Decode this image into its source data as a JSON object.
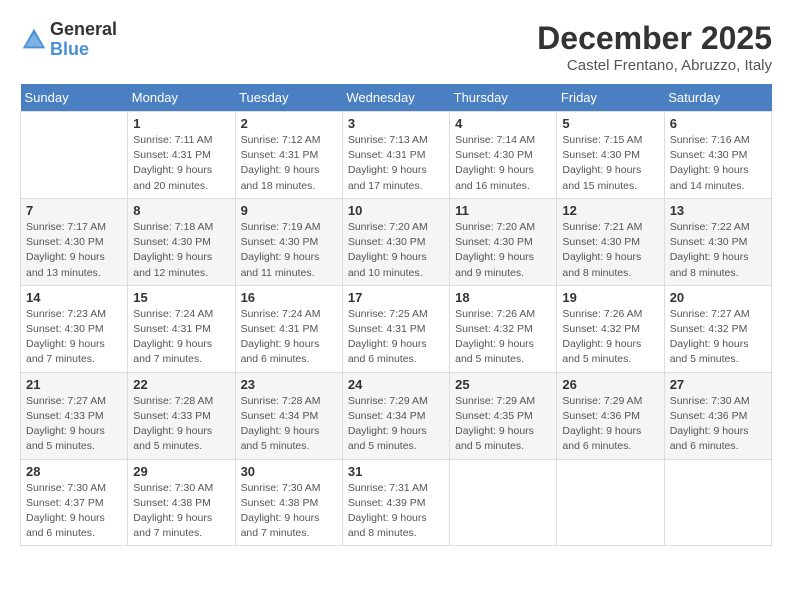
{
  "header": {
    "logo_general": "General",
    "logo_blue": "Blue",
    "month_title": "December 2025",
    "location": "Castel Frentano, Abruzzo, Italy"
  },
  "calendar": {
    "days_of_week": [
      "Sunday",
      "Monday",
      "Tuesday",
      "Wednesday",
      "Thursday",
      "Friday",
      "Saturday"
    ],
    "weeks": [
      [
        {
          "day": "",
          "info": ""
        },
        {
          "day": "1",
          "info": "Sunrise: 7:11 AM\nSunset: 4:31 PM\nDaylight: 9 hours\nand 20 minutes."
        },
        {
          "day": "2",
          "info": "Sunrise: 7:12 AM\nSunset: 4:31 PM\nDaylight: 9 hours\nand 18 minutes."
        },
        {
          "day": "3",
          "info": "Sunrise: 7:13 AM\nSunset: 4:31 PM\nDaylight: 9 hours\nand 17 minutes."
        },
        {
          "day": "4",
          "info": "Sunrise: 7:14 AM\nSunset: 4:30 PM\nDaylight: 9 hours\nand 16 minutes."
        },
        {
          "day": "5",
          "info": "Sunrise: 7:15 AM\nSunset: 4:30 PM\nDaylight: 9 hours\nand 15 minutes."
        },
        {
          "day": "6",
          "info": "Sunrise: 7:16 AM\nSunset: 4:30 PM\nDaylight: 9 hours\nand 14 minutes."
        }
      ],
      [
        {
          "day": "7",
          "info": "Sunrise: 7:17 AM\nSunset: 4:30 PM\nDaylight: 9 hours\nand 13 minutes."
        },
        {
          "day": "8",
          "info": "Sunrise: 7:18 AM\nSunset: 4:30 PM\nDaylight: 9 hours\nand 12 minutes."
        },
        {
          "day": "9",
          "info": "Sunrise: 7:19 AM\nSunset: 4:30 PM\nDaylight: 9 hours\nand 11 minutes."
        },
        {
          "day": "10",
          "info": "Sunrise: 7:20 AM\nSunset: 4:30 PM\nDaylight: 9 hours\nand 10 minutes."
        },
        {
          "day": "11",
          "info": "Sunrise: 7:20 AM\nSunset: 4:30 PM\nDaylight: 9 hours\nand 9 minutes."
        },
        {
          "day": "12",
          "info": "Sunrise: 7:21 AM\nSunset: 4:30 PM\nDaylight: 9 hours\nand 8 minutes."
        },
        {
          "day": "13",
          "info": "Sunrise: 7:22 AM\nSunset: 4:30 PM\nDaylight: 9 hours\nand 8 minutes."
        }
      ],
      [
        {
          "day": "14",
          "info": "Sunrise: 7:23 AM\nSunset: 4:30 PM\nDaylight: 9 hours\nand 7 minutes."
        },
        {
          "day": "15",
          "info": "Sunrise: 7:24 AM\nSunset: 4:31 PM\nDaylight: 9 hours\nand 7 minutes."
        },
        {
          "day": "16",
          "info": "Sunrise: 7:24 AM\nSunset: 4:31 PM\nDaylight: 9 hours\nand 6 minutes."
        },
        {
          "day": "17",
          "info": "Sunrise: 7:25 AM\nSunset: 4:31 PM\nDaylight: 9 hours\nand 6 minutes."
        },
        {
          "day": "18",
          "info": "Sunrise: 7:26 AM\nSunset: 4:32 PM\nDaylight: 9 hours\nand 5 minutes."
        },
        {
          "day": "19",
          "info": "Sunrise: 7:26 AM\nSunset: 4:32 PM\nDaylight: 9 hours\nand 5 minutes."
        },
        {
          "day": "20",
          "info": "Sunrise: 7:27 AM\nSunset: 4:32 PM\nDaylight: 9 hours\nand 5 minutes."
        }
      ],
      [
        {
          "day": "21",
          "info": "Sunrise: 7:27 AM\nSunset: 4:33 PM\nDaylight: 9 hours\nand 5 minutes."
        },
        {
          "day": "22",
          "info": "Sunrise: 7:28 AM\nSunset: 4:33 PM\nDaylight: 9 hours\nand 5 minutes."
        },
        {
          "day": "23",
          "info": "Sunrise: 7:28 AM\nSunset: 4:34 PM\nDaylight: 9 hours\nand 5 minutes."
        },
        {
          "day": "24",
          "info": "Sunrise: 7:29 AM\nSunset: 4:34 PM\nDaylight: 9 hours\nand 5 minutes."
        },
        {
          "day": "25",
          "info": "Sunrise: 7:29 AM\nSunset: 4:35 PM\nDaylight: 9 hours\nand 5 minutes."
        },
        {
          "day": "26",
          "info": "Sunrise: 7:29 AM\nSunset: 4:36 PM\nDaylight: 9 hours\nand 6 minutes."
        },
        {
          "day": "27",
          "info": "Sunrise: 7:30 AM\nSunset: 4:36 PM\nDaylight: 9 hours\nand 6 minutes."
        }
      ],
      [
        {
          "day": "28",
          "info": "Sunrise: 7:30 AM\nSunset: 4:37 PM\nDaylight: 9 hours\nand 6 minutes."
        },
        {
          "day": "29",
          "info": "Sunrise: 7:30 AM\nSunset: 4:38 PM\nDaylight: 9 hours\nand 7 minutes."
        },
        {
          "day": "30",
          "info": "Sunrise: 7:30 AM\nSunset: 4:38 PM\nDaylight: 9 hours\nand 7 minutes."
        },
        {
          "day": "31",
          "info": "Sunrise: 7:31 AM\nSunset: 4:39 PM\nDaylight: 9 hours\nand 8 minutes."
        },
        {
          "day": "",
          "info": ""
        },
        {
          "day": "",
          "info": ""
        },
        {
          "day": "",
          "info": ""
        }
      ]
    ]
  }
}
